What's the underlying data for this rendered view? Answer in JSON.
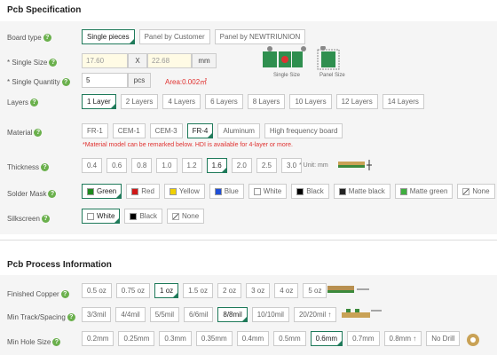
{
  "spec": {
    "title": "Pcb Specification",
    "board_type": {
      "label": "Board type",
      "options": [
        "Single pieces",
        "Panel by Customer",
        "Panel by NEWTRIUNION"
      ],
      "selected": 0
    },
    "single_size": {
      "label": "* Single Size",
      "width": "17.60",
      "sep": "X",
      "height": "22.68",
      "unit": "mm",
      "img_single": "Single Size",
      "img_panel": "Panel Size"
    },
    "single_qty": {
      "label": "* Single Quantity",
      "value": "5",
      "unit": "pcs",
      "area": "Area:0.002㎡"
    },
    "layers": {
      "label": "Layers",
      "options": [
        "1 Layer",
        "2 Layers",
        "4 Layers",
        "6 Layers",
        "8 Layers",
        "10 Layers",
        "12 Layers",
        "14 Layers"
      ],
      "selected": 0
    },
    "material": {
      "label": "Material",
      "options": [
        "FR-1",
        "CEM-1",
        "CEM-3",
        "FR-4",
        "Aluminum",
        "High frequency board"
      ],
      "selected": 3,
      "note": "*Material model can be remarked below. HDI is available for 4-layer or more."
    },
    "thickness": {
      "label": "Thickness",
      "options": [
        "0.4",
        "0.6",
        "0.8",
        "1.0",
        "1.2",
        "1.6",
        "2.0",
        "2.5",
        "3.0"
      ],
      "selected": 5,
      "unit": "* Unit: mm"
    },
    "solder_mask": {
      "label": "Solder Mask",
      "options": [
        {
          "name": "Green",
          "color": "#1e8a1e"
        },
        {
          "name": "Red",
          "color": "#d01818"
        },
        {
          "name": "Yellow",
          "color": "#f0d000"
        },
        {
          "name": "Blue",
          "color": "#1f4fd8"
        },
        {
          "name": "White",
          "color": "#ffffff"
        },
        {
          "name": "Black",
          "color": "#000000"
        },
        {
          "name": "Matte black",
          "color": "#222222"
        },
        {
          "name": "Matte green",
          "color": "#3fae3f"
        },
        {
          "name": "None",
          "color": "none"
        }
      ],
      "selected": 0
    },
    "silkscreen": {
      "label": "Silkscreen",
      "options": [
        {
          "name": "White",
          "color": "#ffffff"
        },
        {
          "name": "Black",
          "color": "#000000"
        },
        {
          "name": "None",
          "color": "none"
        }
      ],
      "selected": 0
    }
  },
  "process": {
    "title": "Pcb Process Information",
    "copper": {
      "label": "Finished Copper",
      "options": [
        "0.5 oz",
        "0.75 oz",
        "1 oz",
        "1.5 oz",
        "2 oz",
        "3 oz",
        "4 oz",
        "5 oz"
      ],
      "selected": 2
    },
    "track": {
      "label": "Min Track/Spacing",
      "options": [
        "3/3mil",
        "4/4mil",
        "5/5mil",
        "6/6mil",
        "8/8mil",
        "10/10mil",
        "20/20mil ↑"
      ],
      "selected": 4
    },
    "hole": {
      "label": "Min Hole Size",
      "options": [
        "0.2mm",
        "0.25mm",
        "0.3mm",
        "0.35mm",
        "0.4mm",
        "0.5mm",
        "0.6mm",
        "0.7mm",
        "0.8mm ↑",
        "No Drill"
      ],
      "selected": 6
    }
  },
  "colors": {
    "accent": "#1f7a5a",
    "help": "#6ab04c",
    "warning": "#e0312f"
  }
}
